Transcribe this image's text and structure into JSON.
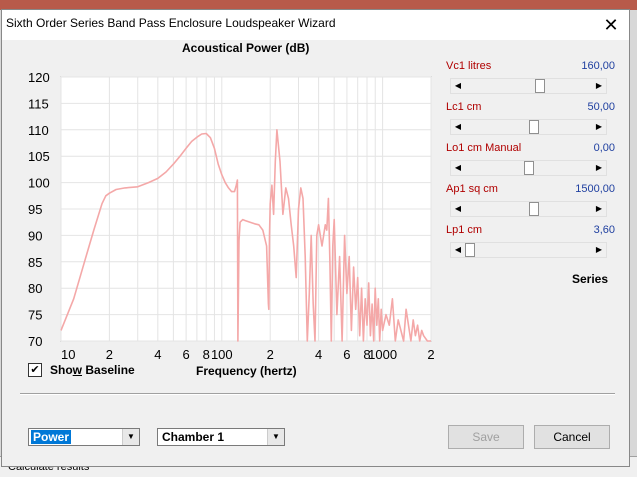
{
  "background": {
    "status_text": "Calculate results"
  },
  "dialog": {
    "title": "Sixth Order Series Band Pass Enclosure Loudspeaker Wizard",
    "close_glyph": "✕"
  },
  "chart_data": {
    "type": "line",
    "title": "Acoustical Power (dB)",
    "xlabel": "Frequency (hertz)",
    "ylabel": "",
    "x_scale": "log",
    "xlim": [
      10,
      2000
    ],
    "ylim": [
      70,
      120
    ],
    "grid": true,
    "y_ticks": [
      "120",
      "115",
      "110",
      "105",
      "100",
      "95",
      "90",
      "85",
      "80",
      "75",
      "70"
    ],
    "x_ticks": [
      "10",
      "2",
      "4",
      "6",
      "8",
      "100",
      "2",
      "4",
      "6",
      "8",
      "1000",
      "2"
    ],
    "x_tick_values": [
      10,
      20,
      40,
      60,
      80,
      100,
      200,
      400,
      600,
      800,
      1000,
      2000
    ],
    "line_color": "#f4a8a8",
    "series": [
      {
        "x": [
          10,
          12,
          14,
          16,
          18,
          19,
          20,
          22,
          25,
          30,
          35,
          40,
          45,
          50,
          55,
          60,
          65,
          70,
          75,
          80,
          85,
          90,
          95,
          100,
          105,
          110,
          115,
          120,
          123,
          125,
          126,
          128,
          130,
          135,
          140,
          150,
          160,
          170,
          180,
          190,
          195,
          196,
          198,
          200,
          205,
          210,
          215,
          220,
          230,
          240,
          250,
          260,
          270,
          280,
          290,
          300,
          310,
          320,
          330,
          340,
          350,
          360,
          370,
          380,
          390,
          400,
          420,
          440,
          450,
          460,
          470,
          480,
          490,
          500,
          520,
          540,
          560,
          580,
          600,
          620,
          640,
          660,
          680,
          700,
          720,
          740,
          760,
          780,
          800,
          820,
          840,
          860,
          880,
          900,
          920,
          940,
          960,
          980,
          1000,
          1050,
          1100,
          1150,
          1200,
          1250,
          1300,
          1350,
          1400,
          1450,
          1500,
          1550,
          1600,
          1650,
          1700,
          1750,
          1800,
          1900,
          2000
        ],
        "y": [
          72,
          78,
          85,
          91,
          96,
          97.5,
          98,
          98.7,
          99,
          99.2,
          100,
          100.8,
          102,
          103.5,
          105,
          106.5,
          107.8,
          108.6,
          109.2,
          109.3,
          108.5,
          106.5,
          103.5,
          101.5,
          100,
          99,
          98.3,
          98.3,
          99.5,
          100.5,
          70,
          89,
          92.5,
          93,
          92.8,
          92.5,
          92.2,
          92,
          91,
          88,
          77,
          76,
          90,
          96,
          99.5,
          94,
          104,
          110,
          104,
          94,
          99,
          97,
          92,
          88,
          82,
          95,
          99,
          97,
          86,
          70,
          79,
          90,
          77,
          70,
          90,
          92,
          88,
          92,
          91,
          97,
          85,
          70,
          88,
          93,
          75,
          86,
          70,
          90,
          79,
          86,
          72,
          84,
          76,
          82,
          71,
          80,
          70,
          78,
          73,
          81,
          71,
          77,
          70,
          80,
          73,
          78,
          70,
          76,
          72,
          75,
          73,
          78,
          70,
          74,
          72,
          70,
          76,
          73,
          70,
          74,
          71,
          73,
          70,
          72,
          71,
          70,
          70
        ]
      }
    ]
  },
  "show_baseline": {
    "checked": true,
    "check_glyph": "✔",
    "label_pre": "Sho",
    "label_ul": "w",
    "label_post": " Baseline"
  },
  "params": [
    {
      "label": "Vc1  litres",
      "value": "160,00",
      "thumb_fraction": 0.6
    },
    {
      "label": "Lc1  cm",
      "value": "50,00",
      "thumb_fraction": 0.55
    },
    {
      "label": "Lo1  cm  Manual",
      "value": "0,00",
      "thumb_fraction": 0.5
    },
    {
      "label": "Ap1  sq cm",
      "value": "1500,00",
      "thumb_fraction": 0.55
    },
    {
      "label": "Lp1  cm",
      "value": "3,60",
      "thumb_fraction": 0.0
    }
  ],
  "scroll_glyphs": {
    "left": "◀",
    "right": "▶"
  },
  "series_label": "Series",
  "combo_power": {
    "value": "Power",
    "arrow": "▼"
  },
  "combo_chamber": {
    "value": "Chamber 1",
    "arrow": "▼"
  },
  "buttons": {
    "save": "Save",
    "cancel": "Cancel"
  }
}
